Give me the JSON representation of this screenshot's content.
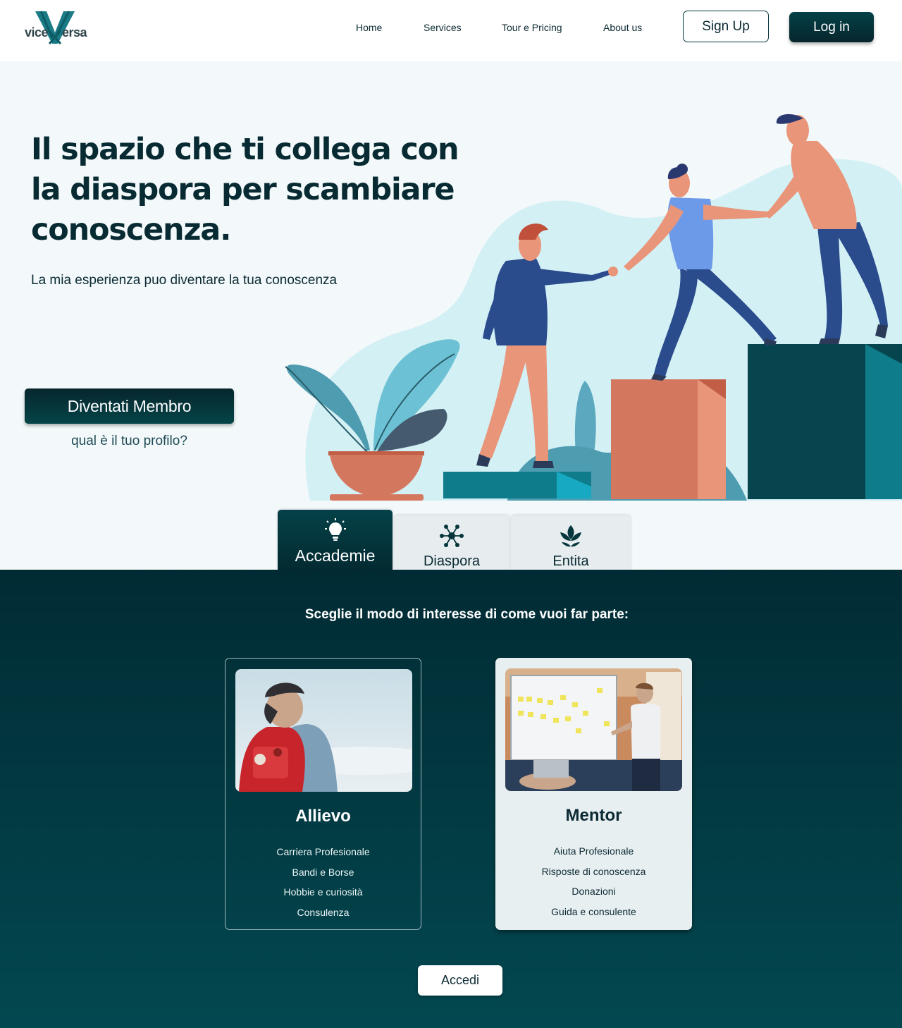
{
  "brand": {
    "logo_part1": "vice",
    "logo_part2": "ersa"
  },
  "nav": {
    "items": [
      {
        "label": "Home"
      },
      {
        "label": "Services"
      },
      {
        "label": "Tour e Pricing"
      },
      {
        "label": "About us"
      }
    ],
    "signup_label": "Sign Up",
    "login_label": "Log in"
  },
  "hero": {
    "title": "Il spazio che ti collega con la diaspora per scambiare conoscenza.",
    "subtitle": "La mia esperienza puo diventare la tua conoscenza",
    "cta_label": "Diventati Membro",
    "cta_sub": "qual è il tuo profilo?"
  },
  "tabs": [
    {
      "label": "Accademie",
      "icon": "lightbulb-icon",
      "active": true
    },
    {
      "label": "Diaspora",
      "icon": "network-icon",
      "active": false
    },
    {
      "label": "Entita",
      "icon": "leaf-icon",
      "active": false
    }
  ],
  "section": {
    "title": "Sceglie il modo di interesse di come vuoi far parte:",
    "cards": [
      {
        "title": "Allievo",
        "items": [
          "Carriera Profesionale",
          "Bandi e Borse",
          "Hobbie e curiosità",
          "Consulenza"
        ]
      },
      {
        "title": "Mentor",
        "items": [
          "Aiuta Profesionale",
          "Risposte di conoscenza",
          "Donazioni",
          "Guida e consulente"
        ]
      }
    ],
    "button_label": "Accedi"
  },
  "colors": {
    "primary_dark": "#06262d",
    "teal": "#044448",
    "accent_orange": "#d4775f",
    "light_blue": "#d3f0f5"
  }
}
